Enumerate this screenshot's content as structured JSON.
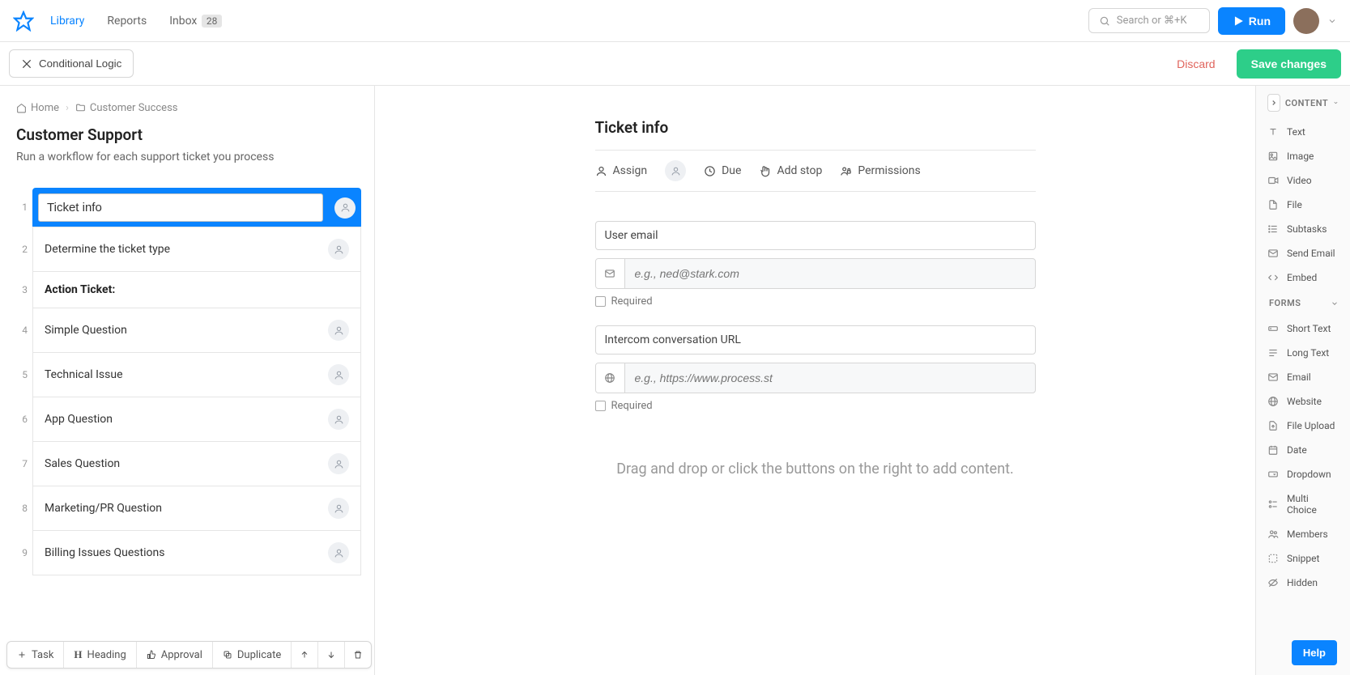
{
  "nav": {
    "library": "Library",
    "reports": "Reports",
    "inbox": "Inbox",
    "inbox_count": "28",
    "search_placeholder": "Search or ⌘+K",
    "run": "Run"
  },
  "subbar": {
    "conditional_logic": "Conditional Logic",
    "discard": "Discard",
    "save": "Save changes"
  },
  "breadcrumb": {
    "home": "Home",
    "folder": "Customer Success"
  },
  "workflow": {
    "title": "Customer Support",
    "description": "Run a workflow for each support ticket you process"
  },
  "tasks": [
    {
      "num": "1",
      "label": "Ticket info",
      "active": true,
      "assignee": true
    },
    {
      "num": "2",
      "label": "Determine the ticket type",
      "assignee": true
    },
    {
      "num": "3",
      "label": "Action Ticket:",
      "heading": true
    },
    {
      "num": "4",
      "label": "Simple Question",
      "assignee": true
    },
    {
      "num": "5",
      "label": "Technical Issue",
      "assignee": true
    },
    {
      "num": "6",
      "label": "App Question",
      "assignee": true
    },
    {
      "num": "7",
      "label": "Sales Question",
      "assignee": true
    },
    {
      "num": "8",
      "label": "Marketing/PR Question",
      "assignee": true
    },
    {
      "num": "9",
      "label": "Billing Issues Questions",
      "assignee": true
    }
  ],
  "content": {
    "title": "Ticket info",
    "actions": {
      "assign": "Assign",
      "due": "Due",
      "add_stop": "Add stop",
      "permissions": "Permissions"
    },
    "fields": [
      {
        "label": "User email",
        "placeholder": "e.g., ned@stark.com",
        "icon": "email",
        "required_label": "Required"
      },
      {
        "label": "Intercom conversation URL",
        "placeholder": "e.g., https://www.process.st",
        "icon": "globe",
        "required_label": "Required"
      }
    ],
    "drop_hint": "Drag and drop or click the buttons on the right to add content."
  },
  "right_panel": {
    "content_header": "CONTENT",
    "content_items": [
      {
        "name": "Text",
        "icon": "text"
      },
      {
        "name": "Image",
        "icon": "image"
      },
      {
        "name": "Video",
        "icon": "video"
      },
      {
        "name": "File",
        "icon": "file"
      },
      {
        "name": "Subtasks",
        "icon": "subtasks"
      },
      {
        "name": "Send Email",
        "icon": "sendemail"
      },
      {
        "name": "Embed",
        "icon": "embed"
      }
    ],
    "forms_header": "FORMS",
    "forms_items": [
      {
        "name": "Short Text",
        "icon": "shorttext"
      },
      {
        "name": "Long Text",
        "icon": "longtext"
      },
      {
        "name": "Email",
        "icon": "email"
      },
      {
        "name": "Website",
        "icon": "globe"
      },
      {
        "name": "File Upload",
        "icon": "fileupload"
      },
      {
        "name": "Date",
        "icon": "date"
      },
      {
        "name": "Dropdown",
        "icon": "dropdown"
      },
      {
        "name": "Multi Choice",
        "icon": "multichoice"
      },
      {
        "name": "Members",
        "icon": "members"
      },
      {
        "name": "Snippet",
        "icon": "snippet"
      },
      {
        "name": "Hidden",
        "icon": "hidden"
      }
    ]
  },
  "toolbar": {
    "task": "Task",
    "heading": "Heading",
    "approval": "Approval",
    "duplicate": "Duplicate"
  },
  "help": "Help"
}
